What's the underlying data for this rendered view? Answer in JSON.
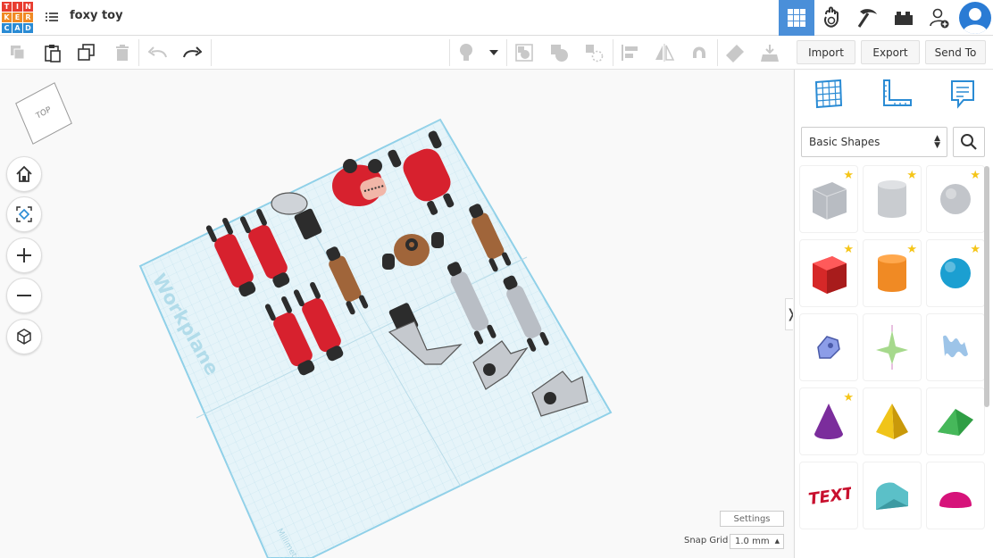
{
  "app": {
    "logo_letters": [
      "T",
      "I",
      "N",
      "K",
      "E",
      "R",
      "C",
      "A",
      "D"
    ],
    "logo_colors": [
      "#e83c2f",
      "#e83c2f",
      "#e83c2f",
      "#f08a24",
      "#f08a24",
      "#f08a24",
      "#2a8bd4",
      "#2a8bd4",
      "#2a8bd4"
    ],
    "design_title": "foxy toy",
    "accent": "#4a8fd9"
  },
  "top_icons": [
    "grid-view-icon",
    "tinker-hand-icon",
    "pickaxe-icon",
    "bricks-icon",
    "add-user-icon",
    "user-avatar"
  ],
  "toolbar": {
    "tools": [
      "copy-icon",
      "paste-icon",
      "duplicate-icon",
      "delete-icon",
      "undo-icon",
      "redo-icon",
      "light-icon",
      "light-dropdown-icon",
      "group-icon",
      "ungroup-icon",
      "hole-icon",
      "align-icon",
      "mirror-icon",
      "magnet-icon",
      "ruler-icon",
      "drop-icon"
    ]
  },
  "actions": {
    "import": "Import",
    "export": "Export",
    "send_to": "Send To"
  },
  "canvas": {
    "viewcube_label": "TOP",
    "workplane_label": "Workplane",
    "units_label": "Millimeters",
    "nav_buttons": [
      "home-icon",
      "fit-view-icon",
      "zoom-in-icon",
      "zoom-out-icon",
      "ortho-view-icon"
    ],
    "settings_label": "Settings",
    "snap_grid_label": "Snap Grid",
    "snap_grid_value": "1.0 mm",
    "collapse_glyph": "❭"
  },
  "panel": {
    "tabs": [
      "workplane-tab-icon",
      "ruler-tab-icon",
      "notes-tab-icon"
    ],
    "library": "Basic Shapes",
    "shapes": [
      {
        "name": "box-hole",
        "color": "#b8bcc2",
        "starred": true
      },
      {
        "name": "cylinder-hole",
        "color": "#c9ccd0",
        "starred": true
      },
      {
        "name": "sphere-hole",
        "color": "#c2c5ca",
        "starred": true
      },
      {
        "name": "box",
        "color": "#d62828",
        "starred": true
      },
      {
        "name": "cylinder",
        "color": "#f08a24",
        "starred": true
      },
      {
        "name": "sphere",
        "color": "#1b9fd1",
        "starred": true
      },
      {
        "name": "scribble",
        "color": "#8c9de8",
        "starred": false
      },
      {
        "name": "shape-generator",
        "color": "#a6d98c",
        "starred": false
      },
      {
        "name": "text-wave",
        "color": "#9dc4e8",
        "starred": false
      },
      {
        "name": "cone",
        "color": "#7b2d9c",
        "starred": true
      },
      {
        "name": "pyramid",
        "color": "#f0c419",
        "starred": false
      },
      {
        "name": "roof",
        "color": "#2f9e44",
        "starred": false
      },
      {
        "name": "text",
        "color": "#c8102e",
        "starred": false
      },
      {
        "name": "round-roof",
        "color": "#5bc0c8",
        "starred": false
      },
      {
        "name": "half-sphere",
        "color": "#d6137a",
        "starred": false
      }
    ],
    "text_shape_label": "TEXT"
  }
}
